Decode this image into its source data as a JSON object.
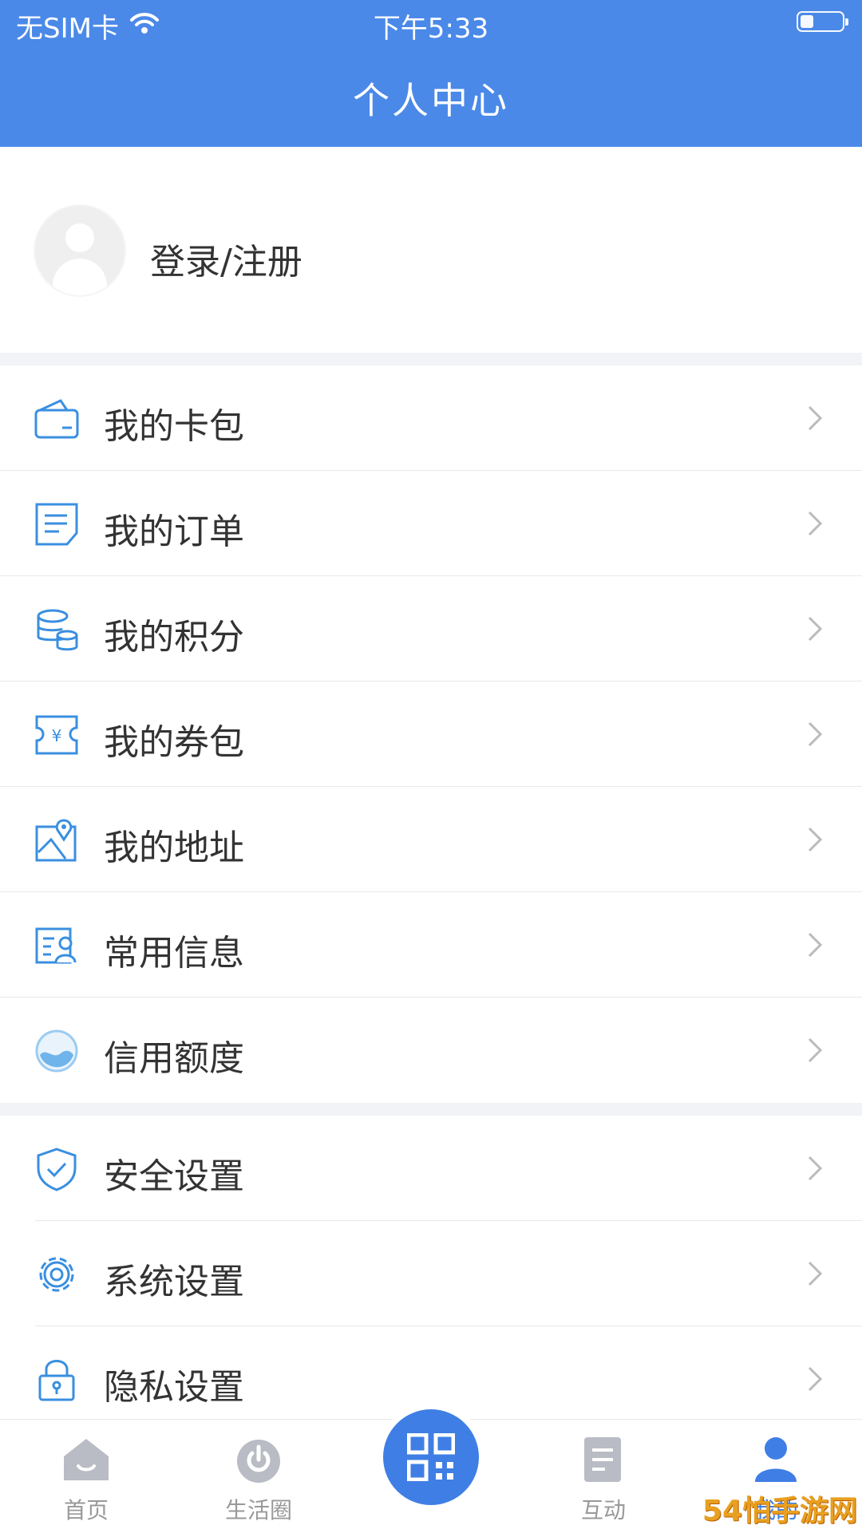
{
  "status": {
    "carrier": "无SIM卡",
    "time": "下午5:33"
  },
  "header": {
    "title": "个人中心"
  },
  "profile": {
    "login_label": "登录/注册"
  },
  "menu": {
    "group1": [
      {
        "label": "我的卡包",
        "icon": "wallet-icon"
      },
      {
        "label": "我的订单",
        "icon": "order-icon"
      },
      {
        "label": "我的积分",
        "icon": "points-icon"
      },
      {
        "label": "我的券包",
        "icon": "coupon-icon"
      },
      {
        "label": "我的地址",
        "icon": "address-icon"
      },
      {
        "label": "常用信息",
        "icon": "contact-info-icon"
      },
      {
        "label": "信用额度",
        "icon": "credit-icon"
      }
    ],
    "group2": [
      {
        "label": "安全设置",
        "icon": "shield-icon"
      },
      {
        "label": "系统设置",
        "icon": "gear-icon"
      },
      {
        "label": "隐私设置",
        "icon": "lock-icon"
      }
    ]
  },
  "tabbar": {
    "items": [
      {
        "label": "首页",
        "icon": "home-icon"
      },
      {
        "label": "生活圈",
        "icon": "life-circle-icon"
      },
      {
        "label": "",
        "icon": "qr-code-icon"
      },
      {
        "label": "互动",
        "icon": "interaction-icon"
      },
      {
        "label": "我的",
        "icon": "user-icon",
        "active": true
      }
    ]
  },
  "watermark": "54怕手游网",
  "colors": {
    "primary": "#4a89e8",
    "icon_blue": "#3a8fe0",
    "text": "#333333",
    "muted": "#999999"
  }
}
